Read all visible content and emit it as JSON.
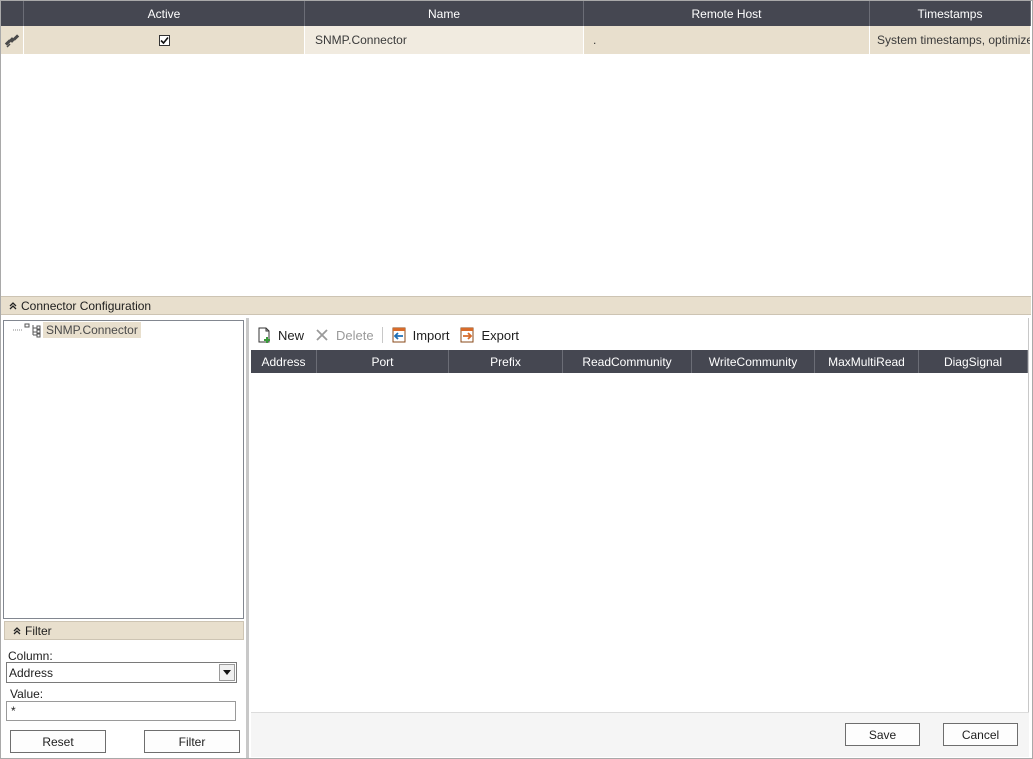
{
  "top_grid": {
    "columns": [
      "Active",
      "Name",
      "Remote Host",
      "Timestamps"
    ],
    "rows": [
      {
        "icon": "satellite-icon",
        "active": true,
        "name": "SNMP.Connector",
        "remote_host": ".",
        "timestamps": "System timestamps, optimize"
      }
    ]
  },
  "config_section": {
    "title": "Connector Configuration"
  },
  "tree": {
    "root_label": "SNMP.Connector"
  },
  "toolbar": {
    "new_label": "New",
    "delete_label": "Delete",
    "import_label": "Import",
    "export_label": "Export"
  },
  "detail_grid": {
    "columns": [
      "Address",
      "Port",
      "Prefix",
      "ReadCommunity",
      "WriteCommunity",
      "MaxMultiRead",
      "DiagSignal"
    ]
  },
  "filter": {
    "title": "Filter",
    "column_label": "Column:",
    "column_value": "Address",
    "value_label": "Value:",
    "value_text": "*",
    "reset_label": "Reset",
    "filter_label": "Filter"
  },
  "actions": {
    "save_label": "Save",
    "cancel_label": "Cancel"
  },
  "colors": {
    "header_bg": "#454751",
    "row_bg": "#e8dfcd",
    "accent": "#d86b2a"
  }
}
